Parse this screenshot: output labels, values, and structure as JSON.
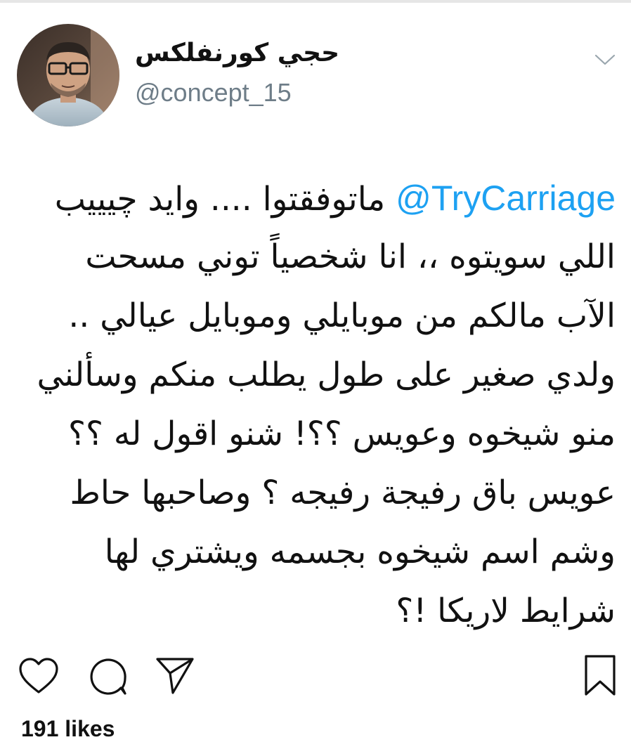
{
  "header": {
    "display_name": "حجي كورنفلكس",
    "handle": "@concept_15",
    "menu_icon": "chevron-down-icon"
  },
  "tweet": {
    "mention": "@TryCarriage",
    "lines": [
      " ماتوفقتوا .... وايد چيييب",
      "اللي سويتوه ،، انا شخصياً توني مسحت",
      "الآب مالكم من موبايلي وموبايل عيالي ..",
      "ولدي صغير على طول يطلب منكم وسألني",
      "منو شيخوه وعويس ؟؟! شنو اقول له ؟؟",
      "عويس باق رفيجة رفيجه ؟ وصاحبها حاط",
      "وشم اسم شيخوه بجسمه ويشتري لها",
      "شرايط لاريكا !؟"
    ],
    "mention_color": "#1da1f2"
  },
  "actions": {
    "icons": [
      "heart-icon",
      "comment-icon",
      "share-icon",
      "bookmark-icon"
    ]
  },
  "likes": "191 likes"
}
